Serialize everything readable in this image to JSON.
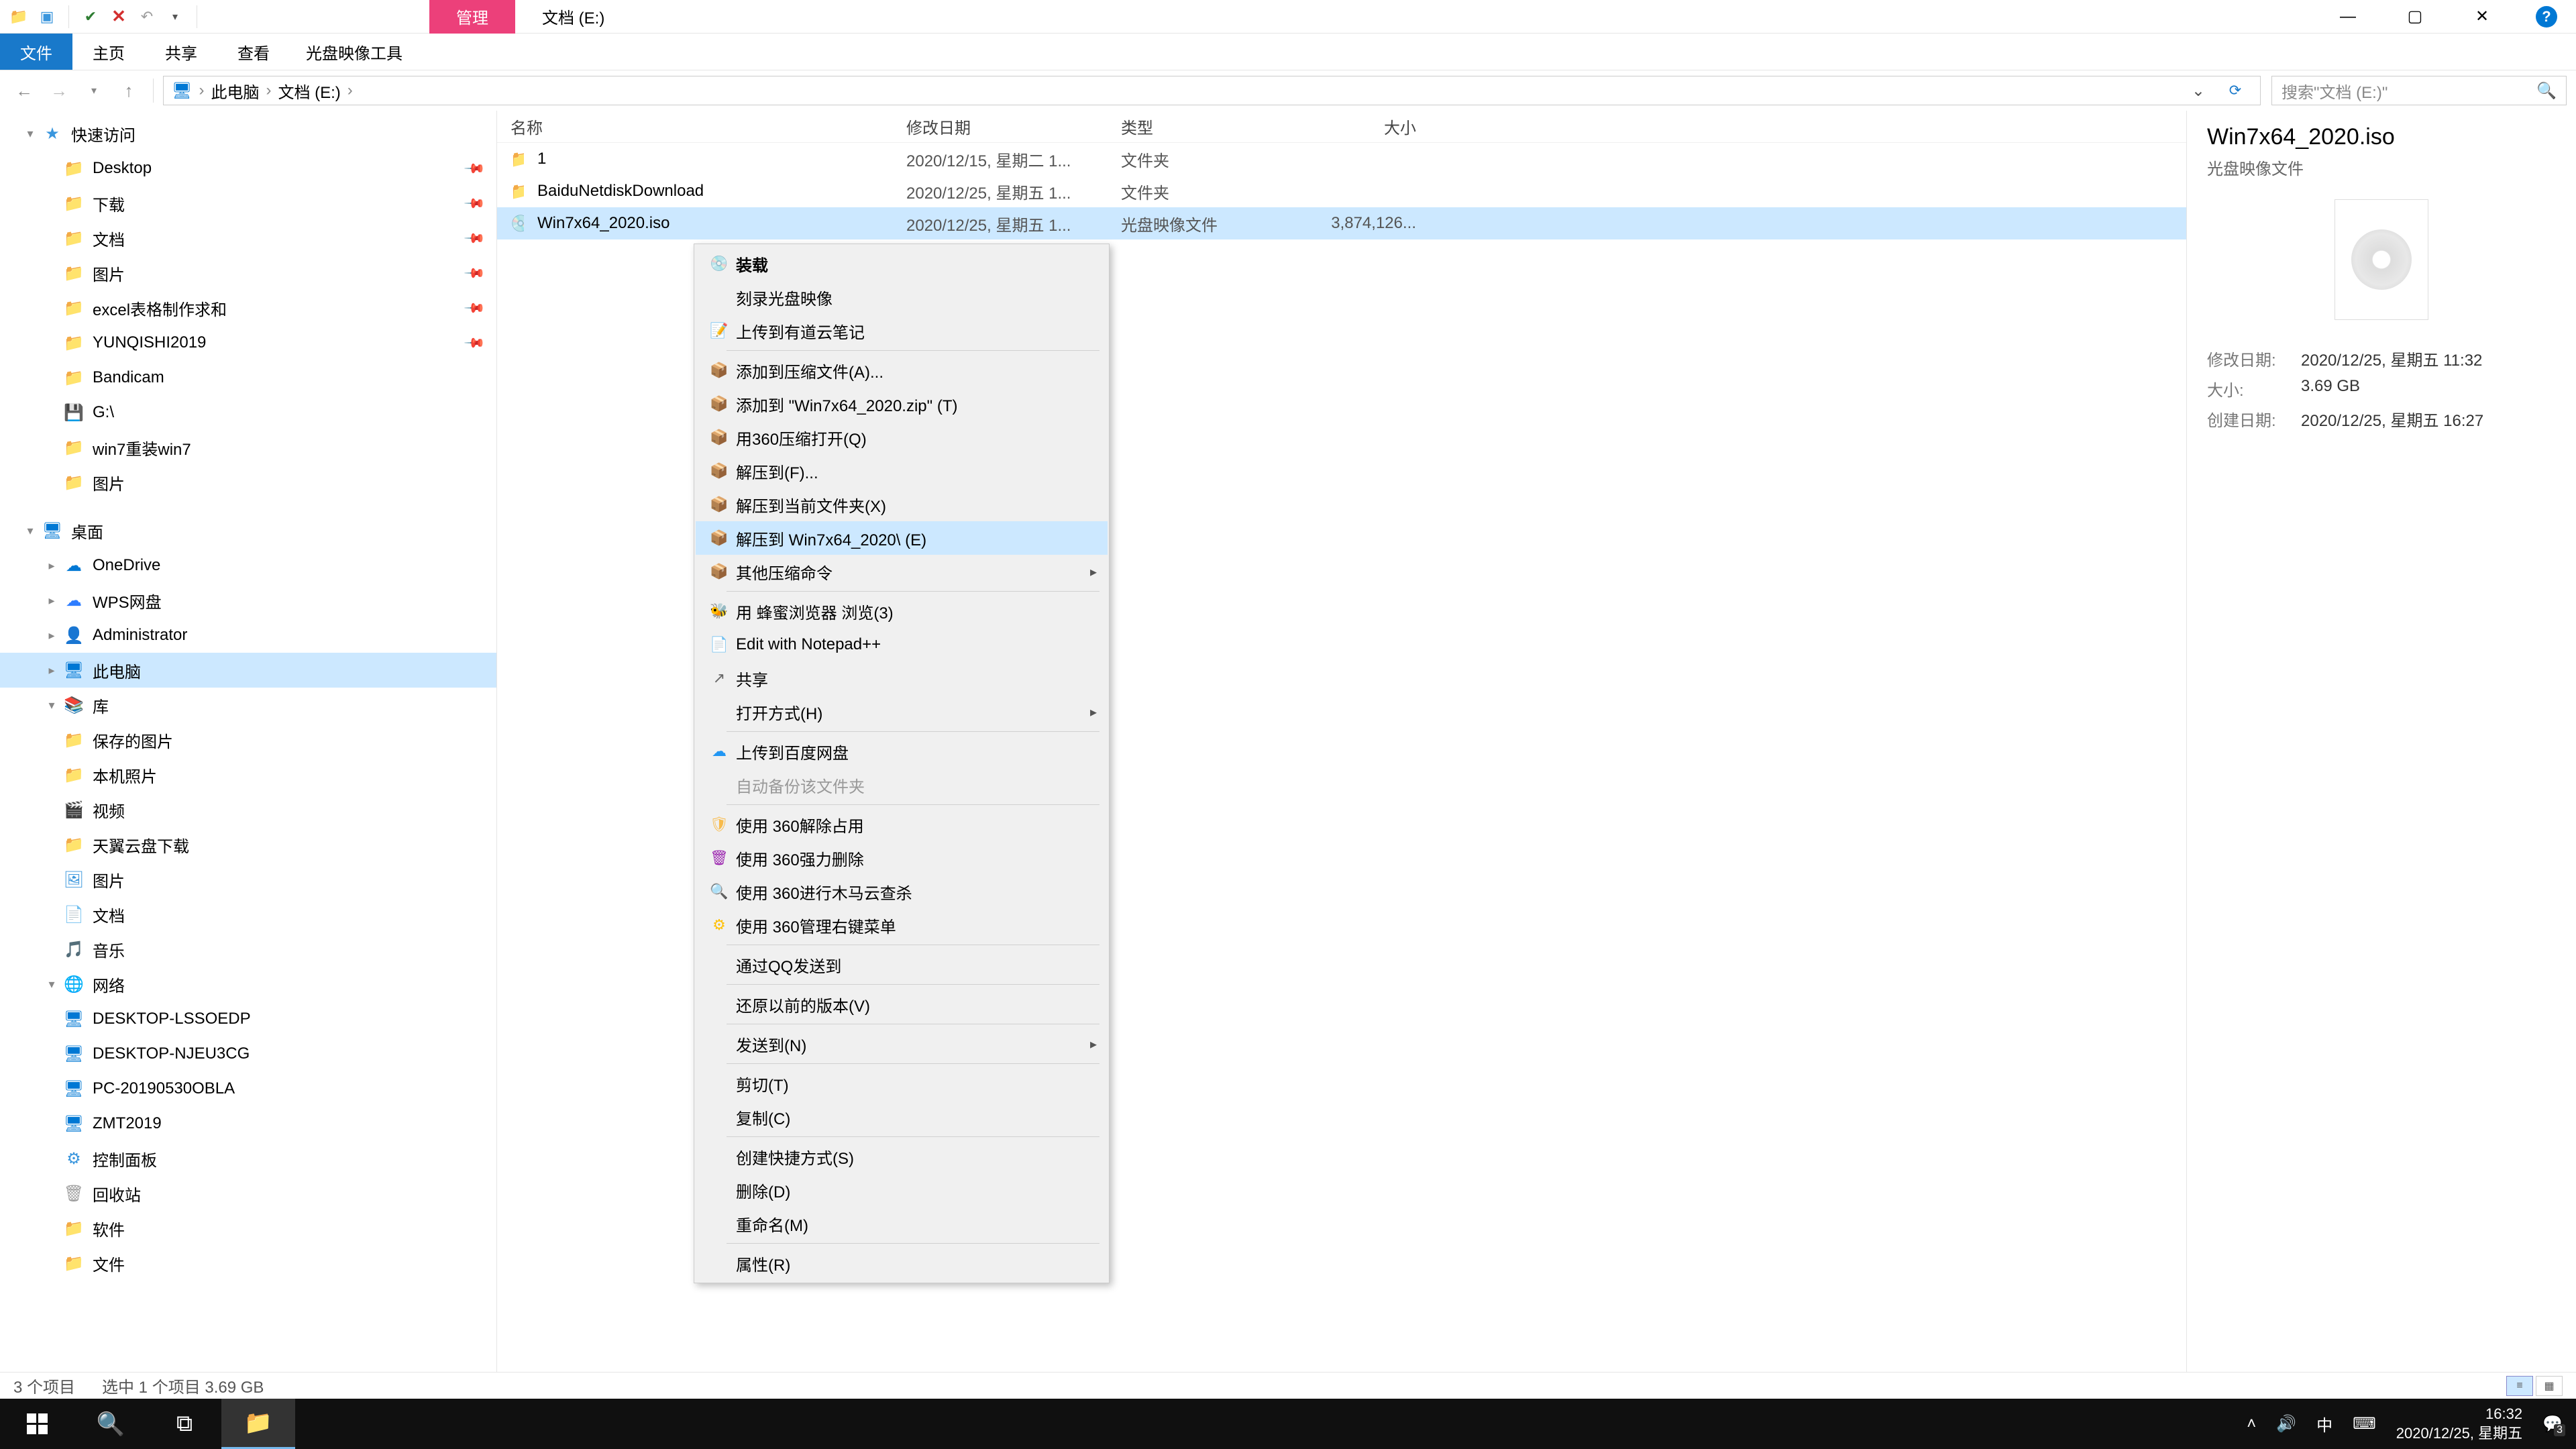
{
  "window": {
    "contextual_tab": "管理",
    "title": "文档 (E:)"
  },
  "ribbon": {
    "file": "文件",
    "home": "主页",
    "share": "共享",
    "view": "查看",
    "iso_tools": "光盘映像工具"
  },
  "nav": {
    "back": "←",
    "fwd": "→",
    "up": "↑",
    "breadcrumb": [
      "此电脑",
      "文档 (E:)"
    ],
    "search_placeholder": "搜索\"文档 (E:)\""
  },
  "tree": [
    {
      "icon": "star",
      "color": "#3a96dd",
      "label": "快速访问",
      "level": 0,
      "exp": "▾"
    },
    {
      "icon": "folder",
      "color": "#3a96dd",
      "label": "Desktop",
      "level": 1,
      "pin": true
    },
    {
      "icon": "folder",
      "color": "#3a96dd",
      "label": "下载",
      "level": 1,
      "pin": true
    },
    {
      "icon": "folder",
      "color": "#3a96dd",
      "label": "文档",
      "level": 1,
      "pin": true
    },
    {
      "icon": "folder",
      "color": "#3a96dd",
      "label": "图片",
      "level": 1,
      "pin": true
    },
    {
      "icon": "folder",
      "color": "#f8bb4b",
      "label": "excel表格制作求和",
      "level": 1,
      "pin": true
    },
    {
      "icon": "folder",
      "color": "#f8bb4b",
      "label": "YUNQISHI2019",
      "level": 1,
      "pin": true
    },
    {
      "icon": "folder",
      "color": "#f8bb4b",
      "label": "Bandicam",
      "level": 1
    },
    {
      "icon": "drive",
      "color": "#9e9e9e",
      "label": "G:\\",
      "level": 1
    },
    {
      "icon": "folder",
      "color": "#f8bb4b",
      "label": "win7重装win7",
      "level": 1
    },
    {
      "icon": "folder",
      "color": "#f8bb4b",
      "label": "图片",
      "level": 1
    },
    {
      "spacer": true
    },
    {
      "icon": "desktop",
      "color": "#0078d4",
      "label": "桌面",
      "level": 0,
      "exp": "▾"
    },
    {
      "icon": "cloud",
      "color": "#0078d4",
      "label": "OneDrive",
      "level": 1,
      "exp": "▸"
    },
    {
      "icon": "cloud",
      "color": "#2e7dff",
      "label": "WPS网盘",
      "level": 1,
      "exp": "▸"
    },
    {
      "icon": "user",
      "color": "#7cb342",
      "label": "Administrator",
      "level": 1,
      "exp": "▸"
    },
    {
      "icon": "pc",
      "color": "#0078d4",
      "label": "此电脑",
      "level": 1,
      "exp": "▸",
      "sel": true
    },
    {
      "icon": "lib",
      "color": "#3a96dd",
      "label": "库",
      "level": 1,
      "exp": "▾"
    },
    {
      "icon": "folder",
      "color": "#f8bb4b",
      "label": "保存的图片",
      "level": 2
    },
    {
      "icon": "folder",
      "color": "#f8bb4b",
      "label": "本机照片",
      "level": 2
    },
    {
      "icon": "video",
      "color": "#3a96dd",
      "label": "视频",
      "level": 2
    },
    {
      "icon": "folder",
      "color": "#f8bb4b",
      "label": "天翼云盘下载",
      "level": 2
    },
    {
      "icon": "pic",
      "color": "#3a96dd",
      "label": "图片",
      "level": 2
    },
    {
      "icon": "doc",
      "color": "#3a96dd",
      "label": "文档",
      "level": 2
    },
    {
      "icon": "music",
      "color": "#3a96dd",
      "label": "音乐",
      "level": 2
    },
    {
      "icon": "net",
      "color": "#0078d4",
      "label": "网络",
      "level": 1,
      "exp": "▾"
    },
    {
      "icon": "pc",
      "color": "#0078d4",
      "label": "DESKTOP-LSSOEDP",
      "level": 2
    },
    {
      "icon": "pc",
      "color": "#0078d4",
      "label": "DESKTOP-NJEU3CG",
      "level": 2
    },
    {
      "icon": "pc",
      "color": "#0078d4",
      "label": "PC-20190530OBLA",
      "level": 2
    },
    {
      "icon": "pc",
      "color": "#0078d4",
      "label": "ZMT2019",
      "level": 2
    },
    {
      "icon": "panel",
      "color": "#3a96dd",
      "label": "控制面板",
      "level": 1
    },
    {
      "icon": "bin",
      "color": "#9e9e9e",
      "label": "回收站",
      "level": 1
    },
    {
      "icon": "folder",
      "color": "#f8bb4b",
      "label": "软件",
      "level": 1
    },
    {
      "icon": "folder",
      "color": "#f8bb4b",
      "label": "文件",
      "level": 1
    }
  ],
  "columns": {
    "name": "名称",
    "date": "修改日期",
    "type": "类型",
    "size": "大小"
  },
  "files": [
    {
      "icon": "folder",
      "name": "1",
      "date": "2020/12/15, 星期二 1...",
      "type": "文件夹",
      "size": ""
    },
    {
      "icon": "folder",
      "name": "BaiduNetdiskDownload",
      "date": "2020/12/25, 星期五 1...",
      "type": "文件夹",
      "size": ""
    },
    {
      "icon": "iso",
      "name": "Win7x64_2020.iso",
      "date": "2020/12/25, 星期五 1...",
      "type": "光盘映像文件",
      "size": "3,874,126...",
      "sel": true
    }
  ],
  "context_menu": [
    {
      "icon": "disc",
      "label": "装载",
      "bold": true
    },
    {
      "label": "刻录光盘映像"
    },
    {
      "icon": "note",
      "label": "上传到有道云笔记",
      "color": "#1976d2"
    },
    {
      "sep": true
    },
    {
      "icon": "zip",
      "label": "添加到压缩文件(A)...",
      "color": "#f8bb4b"
    },
    {
      "icon": "zip",
      "label": "添加到 \"Win7x64_2020.zip\" (T)",
      "color": "#f8bb4b"
    },
    {
      "icon": "zip",
      "label": "用360压缩打开(Q)",
      "color": "#f8bb4b"
    },
    {
      "icon": "zip",
      "label": "解压到(F)...",
      "color": "#f8bb4b"
    },
    {
      "icon": "zip",
      "label": "解压到当前文件夹(X)",
      "color": "#f8bb4b"
    },
    {
      "icon": "zip",
      "label": "解压到 Win7x64_2020\\ (E)",
      "color": "#f8bb4b",
      "hl": true
    },
    {
      "icon": "zip",
      "label": "其他压缩命令",
      "color": "#f8bb4b",
      "arrow": true
    },
    {
      "sep": true
    },
    {
      "icon": "bee",
      "label": "用 蜂蜜浏览器 浏览(3)",
      "color": "#8bc34a"
    },
    {
      "icon": "npp",
      "label": "Edit with Notepad++",
      "color": "#4caf50"
    },
    {
      "icon": "share",
      "label": "共享"
    },
    {
      "label": "打开方式(H)",
      "arrow": true
    },
    {
      "sep": true
    },
    {
      "icon": "baidu",
      "label": "上传到百度网盘",
      "color": "#2196f3"
    },
    {
      "label": "自动备份该文件夹",
      "dis": true
    },
    {
      "sep": true
    },
    {
      "icon": "360",
      "label": "使用 360解除占用",
      "color": "#f8bb4b"
    },
    {
      "icon": "360d",
      "label": "使用 360强力删除",
      "color": "#9c27b0"
    },
    {
      "icon": "360s",
      "label": "使用 360进行木马云查杀",
      "color": "#ffc107"
    },
    {
      "icon": "360m",
      "label": "使用 360管理右键菜单",
      "color": "#ffc107"
    },
    {
      "sep": true
    },
    {
      "label": "通过QQ发送到"
    },
    {
      "sep": true
    },
    {
      "label": "还原以前的版本(V)"
    },
    {
      "sep": true
    },
    {
      "label": "发送到(N)",
      "arrow": true
    },
    {
      "sep": true
    },
    {
      "label": "剪切(T)"
    },
    {
      "label": "复制(C)"
    },
    {
      "sep": true
    },
    {
      "label": "创建快捷方式(S)"
    },
    {
      "label": "删除(D)"
    },
    {
      "label": "重命名(M)"
    },
    {
      "sep": true
    },
    {
      "label": "属性(R)"
    }
  ],
  "preview": {
    "title": "Win7x64_2020.iso",
    "type": "光盘映像文件",
    "meta": [
      {
        "label": "修改日期:",
        "value": "2020/12/25, 星期五 11:32"
      },
      {
        "label": "大小:",
        "value": "3.69 GB"
      },
      {
        "label": "创建日期:",
        "value": "2020/12/25, 星期五 16:27"
      }
    ]
  },
  "status": {
    "count": "3 个项目",
    "selection": "选中 1 个项目  3.69 GB"
  },
  "taskbar": {
    "ime": "中",
    "time": "16:32",
    "date": "2020/12/25, 星期五",
    "notif": "3"
  }
}
